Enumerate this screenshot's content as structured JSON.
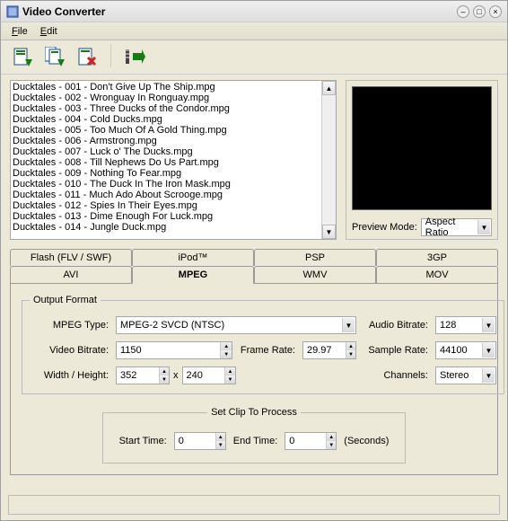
{
  "window": {
    "title": "Video Converter"
  },
  "menu": {
    "file": "File",
    "edit": "Edit"
  },
  "toolbar_icons": [
    "add-file-icon",
    "batch-add-icon",
    "remove-icon",
    "convert-icon"
  ],
  "file_list": [
    "Ducktales - 001 - Don't Give Up The Ship.mpg",
    "Ducktales - 002 - Wronguay In Ronguay.mpg",
    "Ducktales - 003 - Three Ducks of the Condor.mpg",
    "Ducktales - 004 - Cold Ducks.mpg",
    "Ducktales - 005 - Too Much Of A Gold Thing.mpg",
    "Ducktales - 006 - Armstrong.mpg",
    "Ducktales - 007 - Luck o' The Ducks.mpg",
    "Ducktales - 008 - Till Nephews Do Us Part.mpg",
    "Ducktales - 009 - Nothing To Fear.mpg",
    "Ducktales - 010 - The Duck In The Iron Mask.mpg",
    "Ducktales - 011 - Much Ado About Scrooge.mpg",
    "Ducktales - 012 - Spies In Their Eyes.mpg",
    "Ducktales - 013 - Dime Enough For Luck.mpg",
    "Ducktales - 014 - Jungle Duck.mpg"
  ],
  "preview": {
    "mode_label": "Preview Mode:",
    "mode_value": "Aspect Ratio"
  },
  "tabs_top": [
    "Flash (FLV / SWF)",
    "iPod™",
    "PSP",
    "3GP"
  ],
  "tabs_bottom": [
    "AVI",
    "MPEG",
    "WMV",
    "MOV"
  ],
  "active_tab": "MPEG",
  "output_format": {
    "legend": "Output Format",
    "labels": {
      "mpeg_type": "MPEG Type:",
      "video_bitrate": "Video Bitrate:",
      "frame_rate": "Frame Rate:",
      "width_height": "Width / Height:",
      "audio_bitrate": "Audio Bitrate:",
      "sample_rate": "Sample Rate:",
      "channels": "Channels:"
    },
    "values": {
      "mpeg_type": "MPEG-2 SVCD (NTSC)",
      "video_bitrate": "1150",
      "frame_rate": "29.97",
      "width": "352",
      "height": "240",
      "audio_bitrate": "128",
      "sample_rate": "44100",
      "channels": "Stereo"
    }
  },
  "clip": {
    "legend": "Set Clip To Process",
    "start_label": "Start Time:",
    "end_label": "End Time:",
    "start_value": "0",
    "end_value": "0",
    "unit": "(Seconds)"
  },
  "x_sep": "x"
}
